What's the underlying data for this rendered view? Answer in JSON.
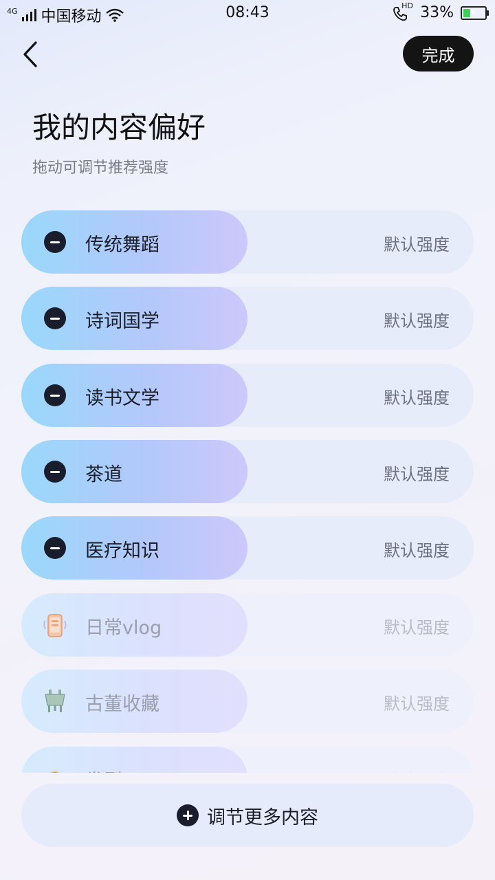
{
  "status_bar": {
    "network": "4G",
    "carrier": "中国移动",
    "time": "08:43",
    "hd": "HD",
    "battery_percent": "33%",
    "battery_level": 0.33
  },
  "header": {
    "done_label": "完成",
    "title": "我的内容偏好",
    "subtitle": "拖动可调节推荐强度"
  },
  "preferences": [
    {
      "label": "传统舞蹈",
      "intensity": "默认强度",
      "state": "active"
    },
    {
      "label": "诗词国学",
      "intensity": "默认强度",
      "state": "active"
    },
    {
      "label": "读书文学",
      "intensity": "默认强度",
      "state": "active"
    },
    {
      "label": "茶道",
      "intensity": "默认强度",
      "state": "active"
    },
    {
      "label": "医疗知识",
      "intensity": "默认强度",
      "state": "active"
    },
    {
      "label": "日常vlog",
      "intensity": "默认强度",
      "state": "inactive",
      "icon": "phone-vlog-icon"
    },
    {
      "label": "古董收藏",
      "intensity": "默认强度",
      "state": "inactive",
      "icon": "bronze-ding-icon"
    },
    {
      "label": "发型",
      "intensity": "默认强度",
      "state": "inactive",
      "icon": "hairstyle-icon"
    }
  ],
  "footer": {
    "more_label": "调节更多内容"
  },
  "colors": {
    "done_button": "#141414",
    "pill_start": "#9ad8fb",
    "pill_end": "#cdc8fb",
    "icon_dark": "#1a1d2b"
  }
}
